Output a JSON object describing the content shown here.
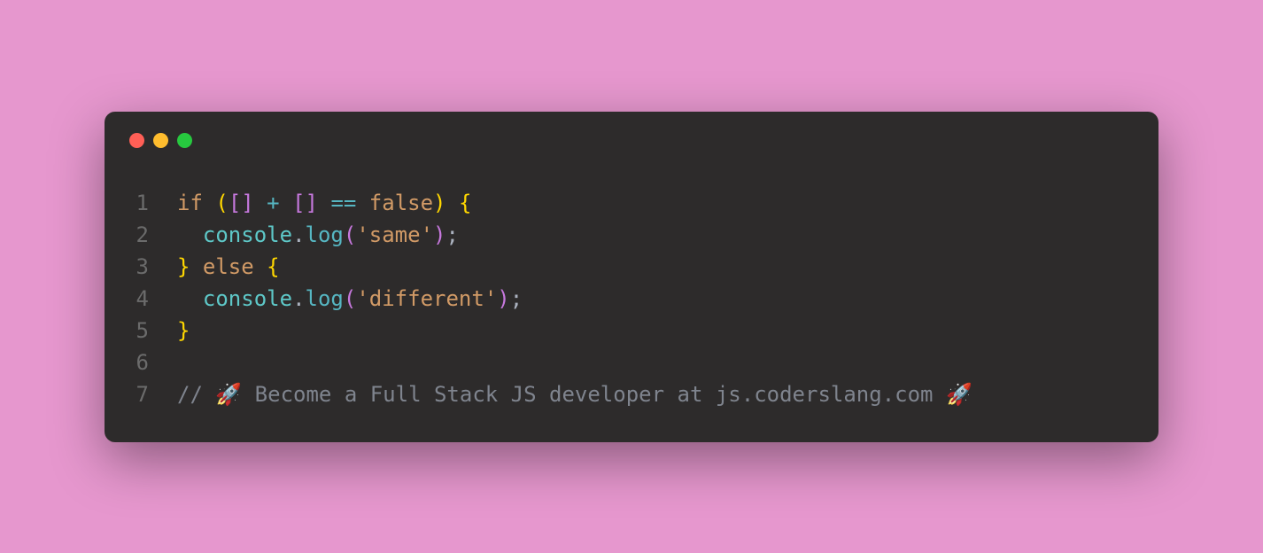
{
  "traffic_lights": {
    "red": "#ff5f56",
    "yellow": "#ffbd2e",
    "green": "#27c93f"
  },
  "line_numbers": [
    "1",
    "2",
    "3",
    "4",
    "5",
    "6",
    "7"
  ],
  "code": {
    "line1": {
      "if": "if",
      "sp1": " ",
      "lparen": "(",
      "lbrack1": "[",
      "rbrack1": "]",
      "sp2": " ",
      "plus": "+",
      "sp3": " ",
      "lbrack2": "[",
      "rbrack2": "]",
      "sp4": " ",
      "eqeq": "==",
      "sp5": " ",
      "false": "false",
      "rparen": ")",
      "sp6": " ",
      "lbrace": "{"
    },
    "line2": {
      "indent": "  ",
      "console": "console",
      "dot": ".",
      "log": "log",
      "lparen": "(",
      "string": "'same'",
      "rparen": ")",
      "semi": ";"
    },
    "line3": {
      "rbrace": "}",
      "sp1": " ",
      "else": "else",
      "sp2": " ",
      "lbrace": "{"
    },
    "line4": {
      "indent": "  ",
      "console": "console",
      "dot": ".",
      "log": "log",
      "lparen": "(",
      "string": "'different'",
      "rparen": ")",
      "semi": ";"
    },
    "line5": {
      "rbrace": "}"
    },
    "line6": {
      "empty": ""
    },
    "line7": {
      "comment": "// 🚀 Become a Full Stack JS developer at js.coderslang.com 🚀"
    }
  }
}
